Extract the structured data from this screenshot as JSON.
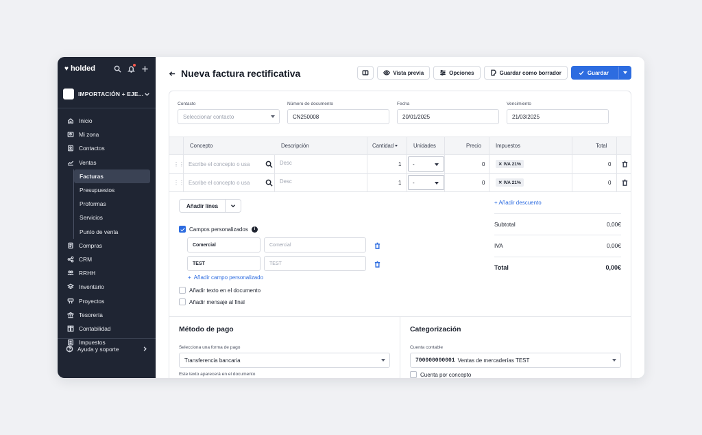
{
  "brand": {
    "name": "holded"
  },
  "company": {
    "name": "IMPORTACIÓN + EJE..."
  },
  "nav": {
    "items": [
      {
        "label": "Inicio",
        "icon": "home-icon"
      },
      {
        "label": "Mi zona",
        "icon": "profile-icon"
      },
      {
        "label": "Contactos",
        "icon": "contacts-icon"
      },
      {
        "label": "Ventas",
        "icon": "sales-chart-icon"
      }
    ],
    "sub": [
      {
        "label": "Facturas"
      },
      {
        "label": "Presupuestos"
      },
      {
        "label": "Proformas"
      },
      {
        "label": "Servicios"
      },
      {
        "label": "Punto de venta"
      }
    ],
    "items2": [
      {
        "label": "Compras",
        "icon": "purchases-icon"
      },
      {
        "label": "CRM",
        "icon": "crm-icon"
      },
      {
        "label": "RRHH",
        "icon": "team-icon"
      },
      {
        "label": "Inventario",
        "icon": "inventory-icon"
      },
      {
        "label": "Proyectos",
        "icon": "projects-icon"
      },
      {
        "label": "Tesorería",
        "icon": "bank-icon"
      },
      {
        "label": "Contabilidad",
        "icon": "accounting-icon"
      },
      {
        "label": "Impuestos",
        "icon": "taxes-icon"
      }
    ],
    "help": "Ayuda y soporte"
  },
  "header": {
    "title": "Nueva factura rectificativa",
    "preview": "Vista previa",
    "options": "Opciones",
    "draft": "Guardar como borrador",
    "save": "Guardar"
  },
  "form": {
    "contact_label": "Contacto",
    "contact_placeholder": "Seleccionar contacto",
    "docnum_label": "Número de documento",
    "docnum_value": "CN250008",
    "date_label": "Fecha",
    "date_value": "20/01/2025",
    "due_label": "Vencimiento",
    "due_value": "21/03/2025"
  },
  "table": {
    "headers": [
      "Concepto",
      "Descripción",
      "Cantidad",
      "Unidades",
      "Precio",
      "Impuestos",
      "Total"
    ],
    "rows": [
      {
        "concept_ph": "Escribe el concepto o usa",
        "desc_ph": "Desc",
        "qty": "1",
        "units": "-",
        "price": "0",
        "tax": "IVA 21%",
        "total": "0"
      },
      {
        "concept_ph": "Escribe el concepto o usa",
        "desc_ph": "Desc",
        "qty": "1",
        "units": "-",
        "price": "0",
        "tax": "IVA 21%",
        "total": "0"
      }
    ]
  },
  "lines": {
    "add_line": "Añadir línea",
    "add_discount": "+ Añadir descuento",
    "custom_fields_label": "Campos personalizados",
    "custom_fields": [
      {
        "name": "Comercial",
        "value_ph": "Comercial"
      },
      {
        "name": "TEST",
        "value_ph": "TEST"
      }
    ],
    "add_custom_field": "Añadir campo personalizado",
    "add_text": "Añadir texto en el documento",
    "add_message": "Añadir mensaje al final"
  },
  "summary": {
    "subtotal_label": "Subtotal",
    "subtotal": "0,00€",
    "iva_label": "IVA",
    "iva": "0,00€",
    "total_label": "Total",
    "total": "0,00€"
  },
  "payment": {
    "title": "Método de pago",
    "select_label": "Selecciona una forma de pago",
    "select_value": "Transferencia bancaria",
    "note": "Este texto aparecerá en el documento"
  },
  "category": {
    "title": "Categorización",
    "account_label": "Cuenta contable",
    "account_code": "700000000001",
    "account_name": "Ventas de mercaderías TEST",
    "per_concept": "Cuenta por concepto"
  },
  "colors": {
    "accent": "#2d6ce0",
    "sidebar": "#1f2533"
  }
}
